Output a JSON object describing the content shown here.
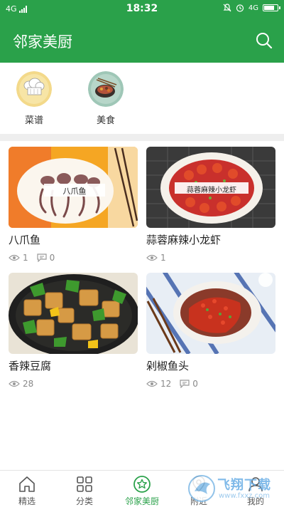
{
  "status_bar": {
    "network": "4G",
    "time": "18:32",
    "network_right": "4G"
  },
  "header": {
    "title": "邻家美厨",
    "search_icon": "search-icon"
  },
  "categories": [
    {
      "label": "菜谱",
      "icon": "chef-hat-icon"
    },
    {
      "label": "美食",
      "icon": "food-bowl-icon"
    }
  ],
  "recipes": [
    {
      "title": "八爪鱼",
      "image_caption": "八爪鱼",
      "views": "1",
      "comments": "0"
    },
    {
      "title": "蒜蓉麻辣小龙虾",
      "image_caption": "蒜蓉麻辣小龙虾",
      "views": "1"
    },
    {
      "title": "香辣豆腐",
      "views": "28"
    },
    {
      "title": "剁椒鱼头",
      "views": "12",
      "comments": "0"
    }
  ],
  "tabbar": [
    {
      "label": "精选",
      "icon": "home-icon",
      "active": false
    },
    {
      "label": "分类",
      "icon": "grid-icon",
      "active": false
    },
    {
      "label": "邻家美厨",
      "icon": "star-circle-icon",
      "active": true
    },
    {
      "label": "附近",
      "icon": "location-icon",
      "active": false
    },
    {
      "label": "我的",
      "icon": "user-icon",
      "active": false
    }
  ],
  "watermark": {
    "text": "飞翔下载",
    "url": "www.fxxz.com"
  },
  "colors": {
    "primary": "#2aa14a",
    "divider": "#eeeeee",
    "muted": "#888888"
  }
}
